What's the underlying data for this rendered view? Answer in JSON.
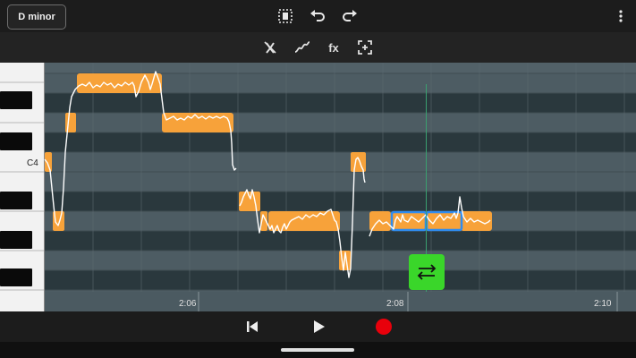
{
  "header": {
    "key_label": "D minor",
    "icons": [
      "select-range-icon",
      "undo-icon",
      "redo-icon",
      "more-vertical-icon"
    ]
  },
  "toolbar": {
    "fx_label": "fx",
    "icons": [
      "mute-note-icon",
      "pitch-curve-icon",
      "fx-icon",
      "snap-to-pitch-icon"
    ]
  },
  "piano": {
    "note_label": "C4"
  },
  "timeline": {
    "markers": [
      "2:06",
      "2:08",
      "2:10"
    ]
  },
  "colors": {
    "note": "#f7a23a",
    "selected_note_border": "#2f8cf0",
    "swap_button": "#3ad62a",
    "record": "#e8000b",
    "playhead": "#3aa070"
  },
  "transport": {
    "icons": [
      "skip-to-start-icon",
      "play-icon",
      "record-icon"
    ]
  }
}
